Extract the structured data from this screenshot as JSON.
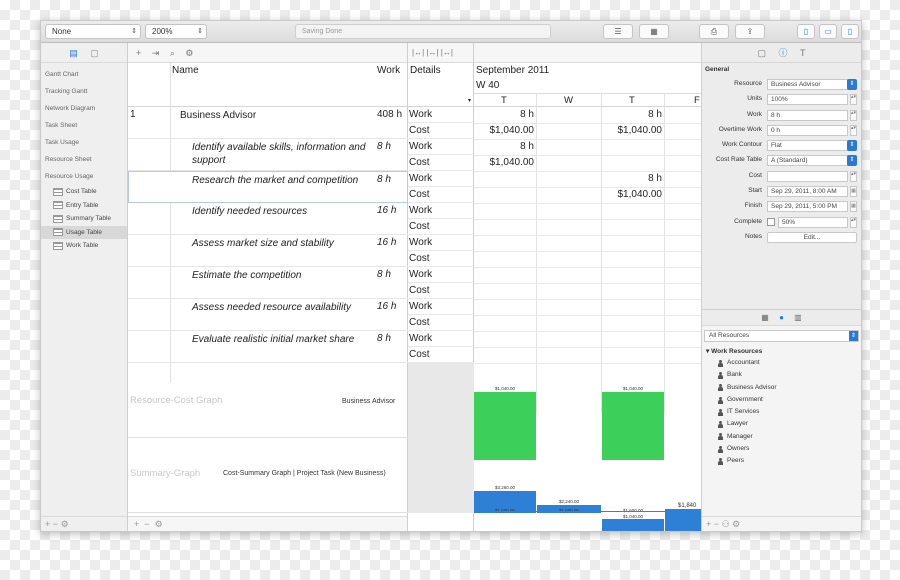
{
  "toolbar": {
    "baseline_select": "None",
    "zoom_select": "200%",
    "status": "Saving Done"
  },
  "sidebar": {
    "items": [
      {
        "label": "Gantt Chart"
      },
      {
        "label": "Tracking Gantt"
      },
      {
        "label": "Network Diagram"
      },
      {
        "label": "Task Sheet"
      },
      {
        "label": "Task Usage"
      },
      {
        "label": "Resource Sheet"
      },
      {
        "label": "Resource Usage"
      }
    ],
    "sub_items": [
      {
        "label": "Cost Table"
      },
      {
        "label": "Entry Table"
      },
      {
        "label": "Summary Table"
      },
      {
        "label": "Usage Table"
      },
      {
        "label": "Work Table"
      }
    ]
  },
  "table": {
    "col_name": "Name",
    "col_work": "Work",
    "col_details": "Details",
    "rows": [
      {
        "num": "1",
        "name": "Business Advisor",
        "work": "408 h"
      },
      {
        "num": "",
        "name": "Identify available skills, information and support",
        "work": "8 h"
      },
      {
        "num": "",
        "name": "Research the market and competition",
        "work": "8 h"
      },
      {
        "num": "",
        "name": "Identify needed resources",
        "work": "16 h"
      },
      {
        "num": "",
        "name": "Assess market size and stability",
        "work": "16 h"
      },
      {
        "num": "",
        "name": "Estimate the competition",
        "work": "8 h"
      },
      {
        "num": "",
        "name": "Assess needed resource availability",
        "work": "16 h"
      },
      {
        "num": "",
        "name": "Evaluate realistic initial market share",
        "work": "8 h"
      }
    ],
    "detail_work": "Work",
    "detail_cost": "Cost",
    "graph1_title": "Resource-Cost Graph",
    "graph1_resource": "Business Advisor",
    "graph2_title": "Summary-Graph",
    "graph2_resource": "Cost-Summary Graph | Project Task (New Business)"
  },
  "timeline": {
    "month": "September 2011",
    "week": "W 40",
    "days": [
      "T",
      "W",
      "T",
      "F"
    ],
    "cells": {
      "r0_work_t1": "8 h",
      "r0_work_t2": "8 h",
      "r0_cost_t1": "$1,040.00",
      "r0_cost_t2": "$1,040.00",
      "r1_work_t1": "8 h",
      "r1_cost_t1": "$1,040.00",
      "r2_work_t2": "8 h",
      "r2_cost_t2": "$1,040.00"
    },
    "bar_labels": {
      "g1_a": "$1,040.00",
      "g1_b": "$1,040.00",
      "g2_a_top": "$3,260.00",
      "g2_a_mid": "$1,600.00",
      "g2_b_top": "$2,240.00",
      "g2_b_mid": "$1,600.00",
      "g2_c_top": "$1,600.00",
      "g2_c_mid": "$1,040.00",
      "g2_d": "$1,840"
    },
    "colors": {
      "green": "#3ccf5a",
      "blue": "#2e7fd6"
    }
  },
  "inspector": {
    "section": "General",
    "fields": [
      {
        "label": "Resource",
        "value": "Business Advisor",
        "kind": "popup"
      },
      {
        "label": "Units",
        "value": "100%",
        "kind": "stepper"
      },
      {
        "label": "Work",
        "value": "8 h",
        "kind": "stepper"
      },
      {
        "label": "Overtime Work",
        "value": "0 h",
        "kind": "stepper"
      },
      {
        "label": "Work Contour",
        "value": "Flat",
        "kind": "popup"
      },
      {
        "label": "Cost Rate Table",
        "value": "A (Standard)",
        "kind": "popup"
      },
      {
        "label": "Cost",
        "value": "",
        "kind": "stepper"
      },
      {
        "label": "Start",
        "value": "Sep 29, 2011, 8:00 AM",
        "kind": "date"
      },
      {
        "label": "Finish",
        "value": "Sep 29, 2011, 5:00 PM",
        "kind": "date"
      },
      {
        "label": "Complete",
        "value": "50%",
        "kind": "check"
      },
      {
        "label": "Notes",
        "value": "Edit...",
        "kind": "button"
      }
    ],
    "resources_select": "All Resources",
    "tree_head": "Work Resources",
    "resources": [
      "Accountant",
      "Bank",
      "Business Advisor",
      "Government",
      "IT Services",
      "Lawyer",
      "Manager",
      "Owners",
      "Peers"
    ]
  }
}
